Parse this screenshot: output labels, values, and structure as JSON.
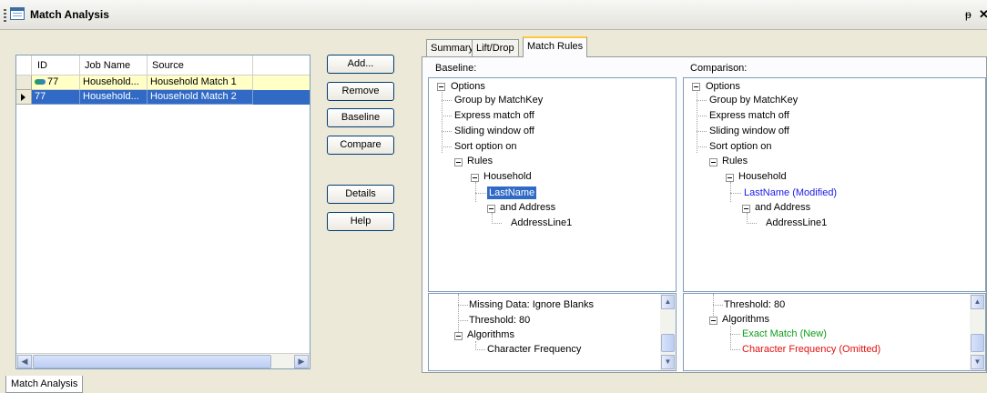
{
  "window": {
    "title": "Match Analysis",
    "pin": "ᵽ",
    "close": "✕"
  },
  "grid": {
    "columns": [
      "ID",
      "Job Name",
      "Source"
    ],
    "rows": [
      {
        "id": "77",
        "job_name": "Household...",
        "source": "Household Match 1"
      },
      {
        "id": "77",
        "job_name": "Household...",
        "source": "Household Match 2"
      }
    ]
  },
  "buttons": {
    "add": "Add...",
    "remove": "Remove",
    "baseline": "Baseline",
    "compare": "Compare",
    "details": "Details",
    "help": "Help"
  },
  "tabs": {
    "summary": "Summary",
    "lift_drop": "Lift/Drop",
    "match_rules": "Match Rules",
    "active": "Match Rules"
  },
  "baseline": {
    "label": "Baseline:",
    "tree": {
      "options": "Options",
      "group_by": "Group by MatchKey",
      "express": "Express match off",
      "sliding": "Sliding window off",
      "sort": "Sort option on",
      "rules": "Rules",
      "household": "Household",
      "lastname": "LastName",
      "and_address": "and Address",
      "addressline1": "AddressLine1"
    },
    "detail": {
      "missing": "Missing Data: Ignore Blanks",
      "threshold": "Threshold: 80",
      "algorithms": "Algorithms",
      "charfreq": "Character Frequency"
    }
  },
  "comparison": {
    "label": "Comparison:",
    "tree": {
      "options": "Options",
      "group_by": "Group by MatchKey",
      "express": "Express match off",
      "sliding": "Sliding window off",
      "sort": "Sort option on",
      "rules": "Rules",
      "household": "Household",
      "lastname": "LastName (Modified)",
      "and_address": "and Address",
      "addressline1": "AddressLine1"
    },
    "detail": {
      "threshold": "Threshold: 80",
      "algorithms": "Algorithms",
      "exact": "Exact Match (New)",
      "charfreq": "Character Frequency (Omitted)"
    }
  },
  "bottom_tab": "Match Analysis"
}
